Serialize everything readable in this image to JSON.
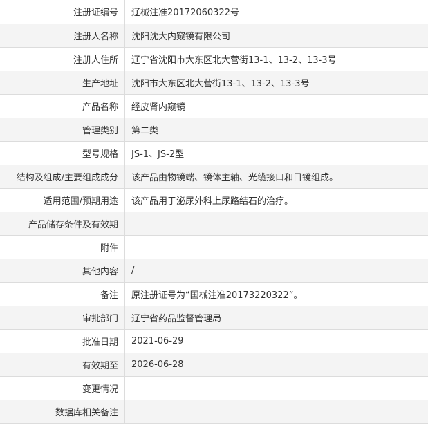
{
  "rows": [
    {
      "label": "注册证编号",
      "value": "辽械注准20172060322号"
    },
    {
      "label": "注册人名称",
      "value": "沈阳沈大内窥镜有限公司"
    },
    {
      "label": "注册人住所",
      "value": "辽宁省沈阳市大东区北大营街13-1、13-2、13-3号"
    },
    {
      "label": "生产地址",
      "value": "沈阳市大东区北大营街13-1、13-2、13-3号"
    },
    {
      "label": "产品名称",
      "value": "经皮肾内窥镜"
    },
    {
      "label": "管理类别",
      "value": "第二类"
    },
    {
      "label": "型号规格",
      "value": "JS-1、JS-2型"
    },
    {
      "label": "结构及组成/主要组成成分",
      "value": "该产品由物镜端、镜体主轴、光缆接口和目镜组成。"
    },
    {
      "label": "适用范围/预期用途",
      "value": "该产品用于泌尿外科上尿路结石的治疗。"
    },
    {
      "label": "产品储存条件及有效期",
      "value": ""
    },
    {
      "label": "附件",
      "value": ""
    },
    {
      "label": "其他内容",
      "value": "/"
    },
    {
      "label": "备注",
      "value": "原注册证号为“国械注准20173220322”。"
    },
    {
      "label": "审批部门",
      "value": "辽宁省药品监督管理局"
    },
    {
      "label": "批准日期",
      "value": "2021-06-29"
    },
    {
      "label": "有效期至",
      "value": "2026-06-28"
    },
    {
      "label": "变更情况",
      "value": ""
    },
    {
      "label": "数据库相关备注",
      "value": ""
    }
  ]
}
